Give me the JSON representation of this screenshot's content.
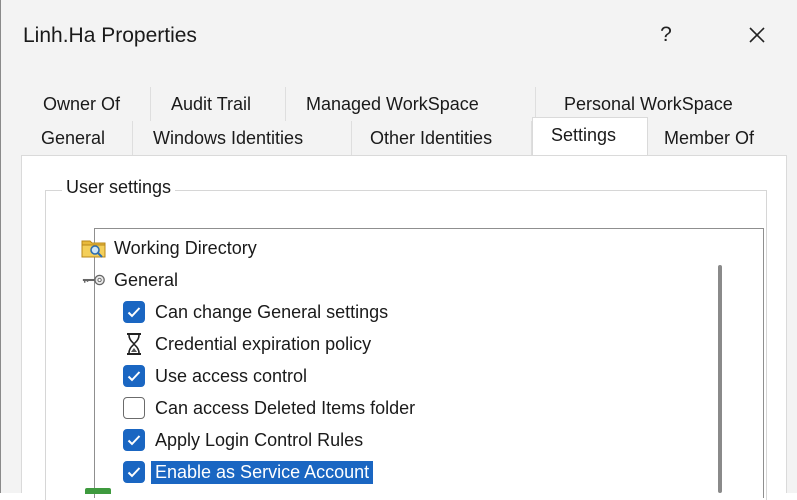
{
  "window": {
    "title": "Linh.Ha Properties",
    "help_label": "?",
    "close_icon": "close-icon"
  },
  "tabs": {
    "row1": [
      {
        "label": "Owner Of",
        "active": false
      },
      {
        "label": "Audit Trail",
        "active": false
      },
      {
        "label": "Managed WorkSpace",
        "active": false
      },
      {
        "label": "Personal WorkSpace",
        "active": false
      }
    ],
    "row2": [
      {
        "label": "General",
        "active": false
      },
      {
        "label": "Windows Identities",
        "active": false
      },
      {
        "label": "Other Identities",
        "active": false
      },
      {
        "label": "Settings",
        "active": true
      },
      {
        "label": "Member Of",
        "active": false
      }
    ]
  },
  "settings": {
    "group_label": "User settings",
    "tree": [
      {
        "label": "Working Directory",
        "icon": "folder-search-icon",
        "level": 0
      },
      {
        "label": "General",
        "icon": "key-icon",
        "level": 0
      },
      {
        "label": "Can change General settings",
        "checkbox": true,
        "checked": true,
        "level": 1
      },
      {
        "label": "Credential expiration policy",
        "icon": "hourglass-icon",
        "level": 1
      },
      {
        "label": "Use access control",
        "checkbox": true,
        "checked": true,
        "level": 1
      },
      {
        "label": "Can access Deleted Items folder",
        "checkbox": true,
        "checked": false,
        "level": 1
      },
      {
        "label": "Apply Login Control Rules",
        "checkbox": true,
        "checked": true,
        "level": 1
      },
      {
        "label": "Enable as Service Account",
        "checkbox": true,
        "checked": true,
        "selected": true,
        "level": 1
      }
    ]
  },
  "colors": {
    "accent": "#1a66c2",
    "window_bg": "#f3f3f3",
    "panel_bg": "#ffffff"
  }
}
